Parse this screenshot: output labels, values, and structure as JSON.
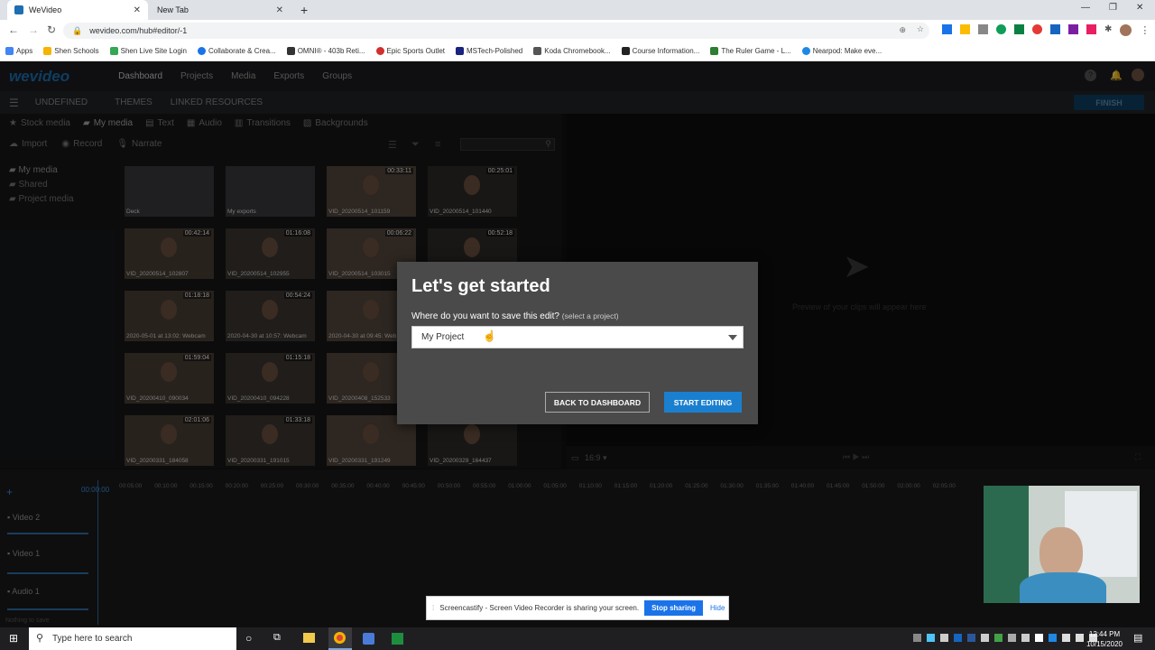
{
  "browser": {
    "tabs": [
      {
        "title": "WeVideo"
      },
      {
        "title": "New Tab"
      }
    ],
    "url": "wevideo.com/hub#editor/-1",
    "bookmarks": [
      {
        "label": "Apps",
        "color": "#4285f4"
      },
      {
        "label": "Shen Schools",
        "color": "#f4b400"
      },
      {
        "label": "Shen Live Site Login",
        "color": "#34a853"
      },
      {
        "label": "Collaborate & Crea...",
        "color": "#1a73e8"
      },
      {
        "label": "OMNI® - 403b Reti...",
        "color": "#333333"
      },
      {
        "label": "Epic Sports Outlet",
        "color": "#d32f2f"
      },
      {
        "label": "MSTech-Polished",
        "color": "#1a237e"
      },
      {
        "label": "Koda Chromebook...",
        "color": "#555555"
      },
      {
        "label": "Course Information...",
        "color": "#222222"
      },
      {
        "label": "The Ruler Game - L...",
        "color": "#2e7d32"
      },
      {
        "label": "Nearpod: Make eve...",
        "color": "#1e88e5"
      }
    ]
  },
  "app": {
    "logo": "wevideo",
    "nav": [
      "Dashboard",
      "Projects",
      "Media",
      "Exports",
      "Groups"
    ],
    "subnav": [
      "UNDEFINED",
      "THEMES",
      "LINKED RESOURCES"
    ],
    "finish_label": "FINISH",
    "media_tabs": [
      "Stock media",
      "My media",
      "Text",
      "Audio",
      "Transitions",
      "Backgrounds"
    ],
    "actions": [
      "Import",
      "Record",
      "Narrate"
    ],
    "folders": [
      "My media",
      "Shared",
      "Project media"
    ],
    "thumbnails": [
      {
        "duration": "",
        "name": "Deck"
      },
      {
        "duration": "",
        "name": "My exports"
      },
      {
        "duration": "00:33:11",
        "name": "VID_20200514_101159"
      },
      {
        "duration": "00:25:01",
        "name": "VID_20200514_101440"
      },
      {
        "duration": "00:42:14",
        "name": "VID_20200514_102807"
      },
      {
        "duration": "01:16:08",
        "name": "VID_20200514_102955"
      },
      {
        "duration": "00:06:22",
        "name": "VID_20200514_103015"
      },
      {
        "duration": "00:52:18",
        "name": ""
      },
      {
        "duration": "01:18:18",
        "name": "2020-05-01 at 13:02: Webcam"
      },
      {
        "duration": "00:54:24",
        "name": "2020-04-30 at 10:57: Webcam"
      },
      {
        "duration": "",
        "name": "2020-04-30 at 09:45: Web"
      },
      {
        "duration": "",
        "name": ""
      },
      {
        "duration": "01:59:04",
        "name": "VID_20200410_090034"
      },
      {
        "duration": "01:15:18",
        "name": "VID_20200410_094228"
      },
      {
        "duration": "",
        "name": "VID_20200408_152533"
      },
      {
        "duration": "",
        "name": ""
      },
      {
        "duration": "02:01:06",
        "name": "VID_20200331_184058"
      },
      {
        "duration": "01:33:18",
        "name": "VID_20200331_191015"
      },
      {
        "duration": "",
        "name": "VID_20200331_191249"
      },
      {
        "duration": "",
        "name": "VID_20200329_164437"
      }
    ],
    "preview_placeholder": "Preview of your clips will appear here",
    "aspect_ratio": "16:9",
    "timecode": "00:00:00",
    "ruler_ticks": [
      "00:05:00",
      "00:10:00",
      "00:15:00",
      "00:20:00",
      "00:25:00",
      "00:30:00",
      "00:35:00",
      "00:40:00",
      "00:45:00",
      "00:50:00",
      "00:55:00",
      "01:00:00",
      "01:05:00",
      "01:10:00",
      "01:15:00",
      "01:20:00",
      "01:25:00",
      "01:30:00",
      "01:35:00",
      "01:40:00",
      "01:45:00",
      "01:50:00",
      "02:00:00",
      "02:05:00"
    ],
    "tracks": [
      "Video 2",
      "Video 1",
      "Audio 1"
    ],
    "footer_note": "Nothing to save"
  },
  "dialog": {
    "title": "Let's get started",
    "question": "Where do you want to save this edit?",
    "hint": "(select a project)",
    "selected_project": "My Project",
    "back_label": "BACK TO DASHBOARD",
    "start_label": "START EDITING"
  },
  "share_bar": {
    "message": "Screencastify - Screen Video Recorder is sharing your screen.",
    "stop_label": "Stop sharing",
    "hide_label": "Hide"
  },
  "taskbar": {
    "search_placeholder": "Type here to search",
    "time": "12:44 PM",
    "date": "10/15/2020"
  }
}
